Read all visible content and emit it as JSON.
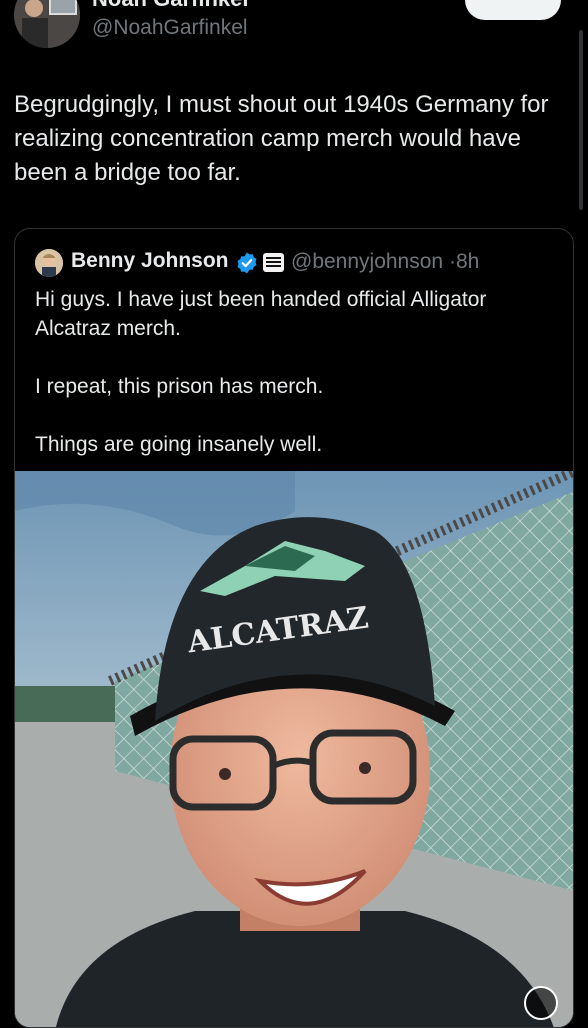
{
  "author": {
    "name": "Noah Garfinkel",
    "handle": "@NoahGarfinkel"
  },
  "follow_button": {
    "label": ""
  },
  "tweet": {
    "text": "Begrudgingly, I must shout out 1940s Germany for realizing concentration camp merch would have been a bridge too far."
  },
  "quote": {
    "name": "Benny Johnson",
    "handle": "@bennyjohnson",
    "separator": "·",
    "time": "8h",
    "paragraphs": [
      "Hi guys. I have just been handed official Alligator Alcatraz merch.",
      "I repeat, this prison has merch.",
      "Things are going insanely well."
    ],
    "affiliate_badge_icon": "affiliate-badge-icon",
    "verified_icon": "verified-badge-icon"
  },
  "media": {
    "hat_text": "ALCATRAZ"
  },
  "colors": {
    "background": "#000000",
    "text": "#e7e9ea",
    "secondary": "#71767b",
    "border": "#2f3336",
    "verified": "#1d9bf0"
  }
}
